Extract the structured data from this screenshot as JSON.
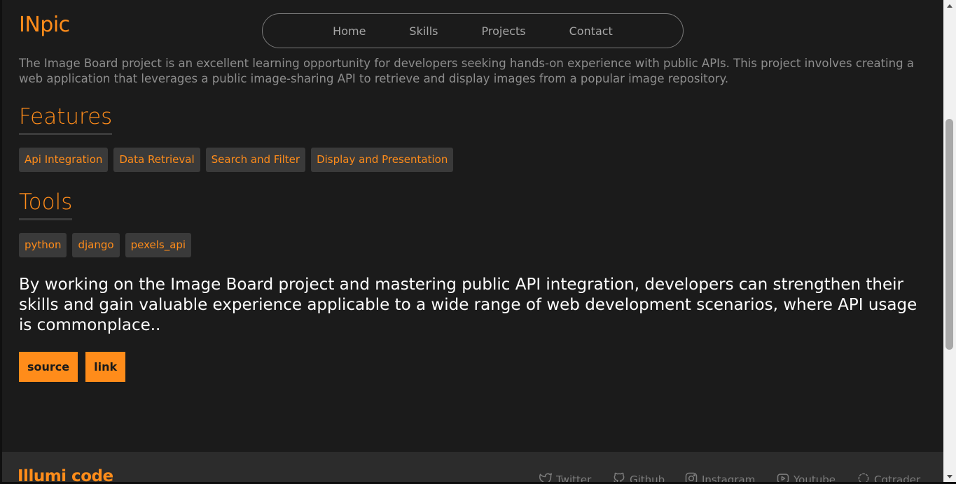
{
  "header": {
    "brand": "INpic",
    "nav": [
      "Home",
      "Skills",
      "Projects",
      "Contact"
    ]
  },
  "project": {
    "intro": "The Image Board project is an excellent learning opportunity for developers seeking hands-on experience with public APIs. This project involves creating a web application that leverages a public image-sharing API to retrieve and display images from a popular image repository.",
    "features_title": "Features",
    "features": [
      "Api Integration",
      "Data Retrieval",
      "Search and Filter",
      "Display and Presentation"
    ],
    "tools_title": "Tools",
    "tools": [
      "python",
      "django",
      "pexels_api"
    ],
    "summary": "By working on the Image Board project and mastering public API integration, developers can strengthen their skills and gain valuable experience applicable to a wide range of web development scenarios, where API usage is commonplace..",
    "buttons": [
      "source",
      "link"
    ]
  },
  "footer": {
    "brand": "Illumi code",
    "links": [
      {
        "label": "Twitter",
        "icon": "twitter-icon"
      },
      {
        "label": "Github",
        "icon": "github-icon"
      },
      {
        "label": "Instagram",
        "icon": "instagram-icon"
      },
      {
        "label": "Youtube",
        "icon": "youtube-icon"
      },
      {
        "label": "Cgtrader",
        "icon": "cgtrader-icon"
      }
    ]
  },
  "scrollbar": {
    "position_fraction": 0.47
  },
  "colors": {
    "accent": "#ff8c1a",
    "background": "#1b1b1b",
    "chip_background": "#3a3a3a",
    "footer_background": "#2c2c2c"
  }
}
